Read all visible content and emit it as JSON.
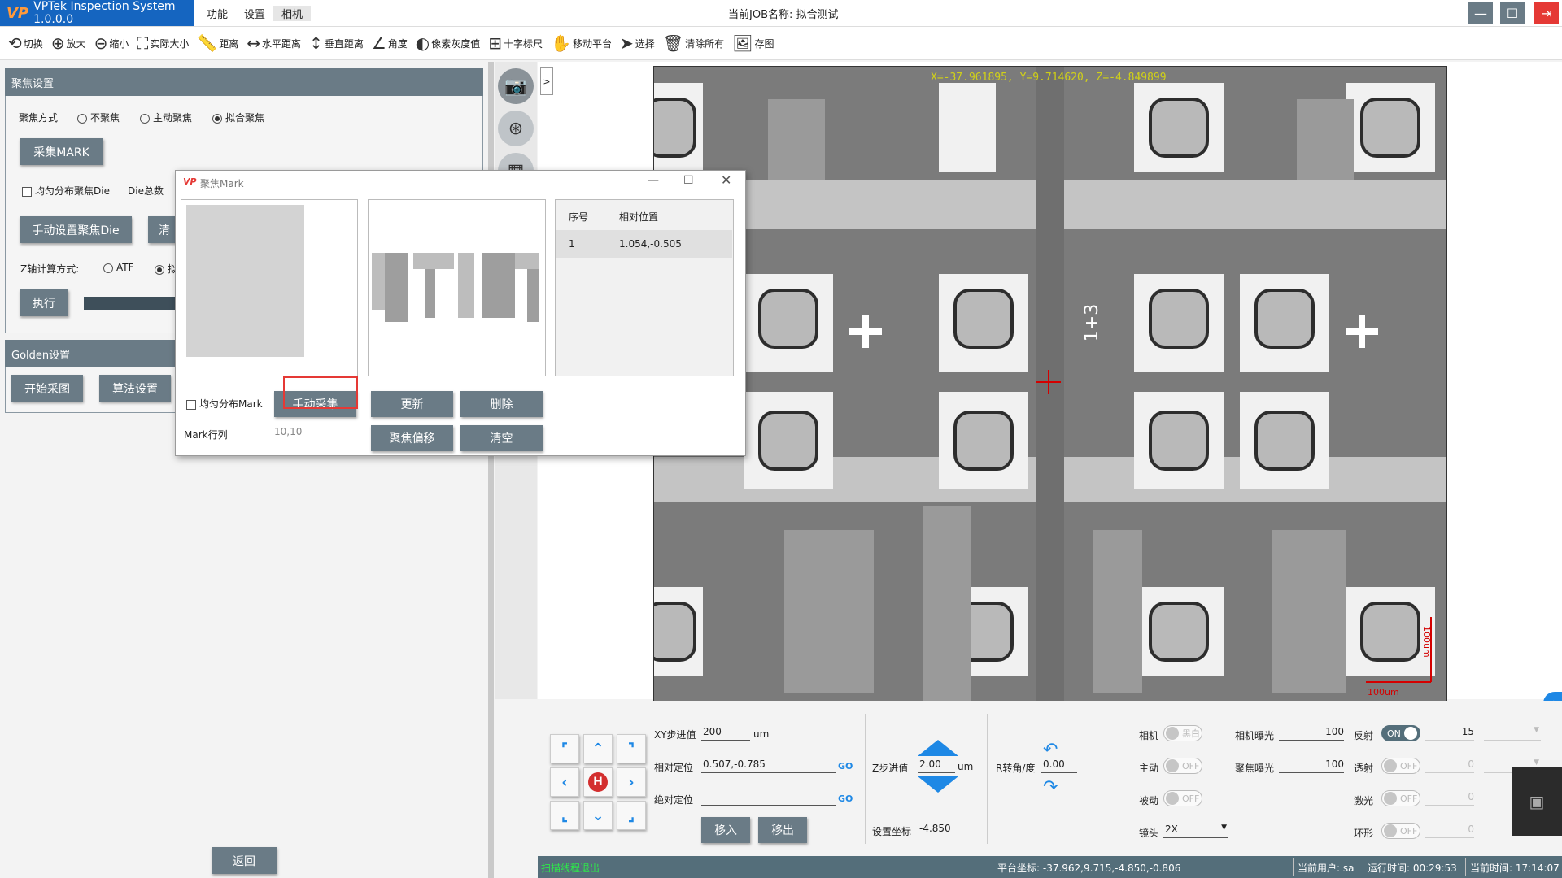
{
  "app": {
    "logo": "VP",
    "title": "VPTek Inspection System 1.0.0.0",
    "menu": [
      "功能",
      "设置",
      "相机"
    ],
    "job_label": "当前JOB名称:  拟合测试"
  },
  "toolbar": [
    {
      "icon": "switch-icon",
      "glyph": "⟲",
      "label": "切换"
    },
    {
      "icon": "zoom-in-icon",
      "glyph": "⊕",
      "label": "放大"
    },
    {
      "icon": "zoom-out-icon",
      "glyph": "⊖",
      "label": "缩小"
    },
    {
      "icon": "actual-size-icon",
      "glyph": "⛶",
      "label": "实际大小"
    },
    {
      "icon": "ruler-icon",
      "glyph": "📏",
      "label": "距离"
    },
    {
      "icon": "horizontal-distance-icon",
      "glyph": "↔",
      "label": "水平距离"
    },
    {
      "icon": "vertical-distance-icon",
      "glyph": "↕",
      "label": "垂直距离"
    },
    {
      "icon": "angle-icon",
      "glyph": "∠",
      "label": "角度"
    },
    {
      "icon": "gray-value-icon",
      "glyph": "◐",
      "label": "像素灰度值"
    },
    {
      "icon": "crosshair-icon",
      "glyph": "⊞",
      "label": "十字标尺"
    },
    {
      "icon": "hand-icon",
      "glyph": "✋",
      "label": "移动平台"
    },
    {
      "icon": "cursor-icon",
      "glyph": "➤",
      "label": "选择"
    },
    {
      "icon": "trash-icon",
      "glyph": "🗑",
      "label": "清除所有"
    },
    {
      "icon": "save-image-icon",
      "glyph": "🖼",
      "label": "存图"
    }
  ],
  "focus": {
    "title": "聚焦设置",
    "mode_label": "聚焦方式",
    "modes": [
      "不聚焦",
      "主动聚焦",
      "拟合聚焦"
    ],
    "collect_mark": "采集MARK",
    "uniform_die": "均匀分布聚焦Die",
    "die_total": "Die总数",
    "manual_die": "手动设置聚焦Die",
    "clear_prefix": "清",
    "z_calc_label": "Z轴计算方式:",
    "z_atf": "ATF",
    "z_other": "拟",
    "execute": "执行"
  },
  "golden": {
    "title": "Golden设置",
    "start": "开始采图",
    "algo": "算法设置"
  },
  "back": "返回",
  "dialog": {
    "logo": "VP",
    "title": "聚焦Mark",
    "table_headers": [
      "序号",
      "相对位置"
    ],
    "rows": [
      {
        "idx": "1",
        "pos": "1.054,-0.505"
      }
    ],
    "uniform_mark": "均匀分布Mark",
    "manual_collect": "手动采集",
    "update": "更新",
    "delete": "删除",
    "focus_offset": "聚焦偏移",
    "clear": "清空",
    "mark_rowcol_label": "Mark行列",
    "mark_rowcol_value": "10,10"
  },
  "image": {
    "coord": "X=-37.961895, Y=9.714620, Z=-4.849899",
    "scale_v": "100um",
    "scale_h": "100um",
    "die_label": "1+3"
  },
  "motion": {
    "xy_step_label": "XY步进值",
    "xy_step": "200",
    "xy_unit": "um",
    "rel_pos_label": "相对定位",
    "rel_pos": "0.507,-0.785",
    "abs_pos_label": "绝对定位",
    "abs_pos": "",
    "go": "GO",
    "move_in": "移入",
    "move_out": "移出",
    "z_step_label": "Z步进值",
    "z_step": "2.00",
    "z_unit": "um",
    "set_coord_label": "设置坐标",
    "set_coord": "-4.850",
    "r_label": "R转角/度",
    "r_value": "0.00",
    "home": "H"
  },
  "lights": {
    "camera": "相机",
    "camera_toggle": "黑白",
    "active": "主动",
    "active_toggle": "OFF",
    "passive": "被动",
    "passive_toggle": "OFF",
    "lens": "镜头",
    "lens_value": "2X",
    "cam_exposure_label": "相机曝光",
    "cam_exposure": "100",
    "focus_exposure_label": "聚焦曝光",
    "focus_exposure": "100",
    "reflect": "反射",
    "reflect_toggle": "ON",
    "reflect_value": "15",
    "transmit": "透射",
    "transmit_toggle": "OFF",
    "transmit_value": "0",
    "laser": "激光",
    "laser_toggle": "OFF",
    "laser_value": "0",
    "ring": "环形",
    "ring_toggle": "OFF",
    "ring_value": "0"
  },
  "status": {
    "left": "扫描线程退出",
    "platform": "平台坐标:  -37.962,9.715,-4.850,-0.806",
    "user": "当前用户:  sa",
    "runtime": "运行时间:  00:29:53",
    "time": "当前时间:  17:14:07"
  },
  "colors": {
    "accent": "#6a7b86",
    "title_blue": "#1565c0",
    "status": "#546e7a",
    "close_red": "#e53935"
  }
}
